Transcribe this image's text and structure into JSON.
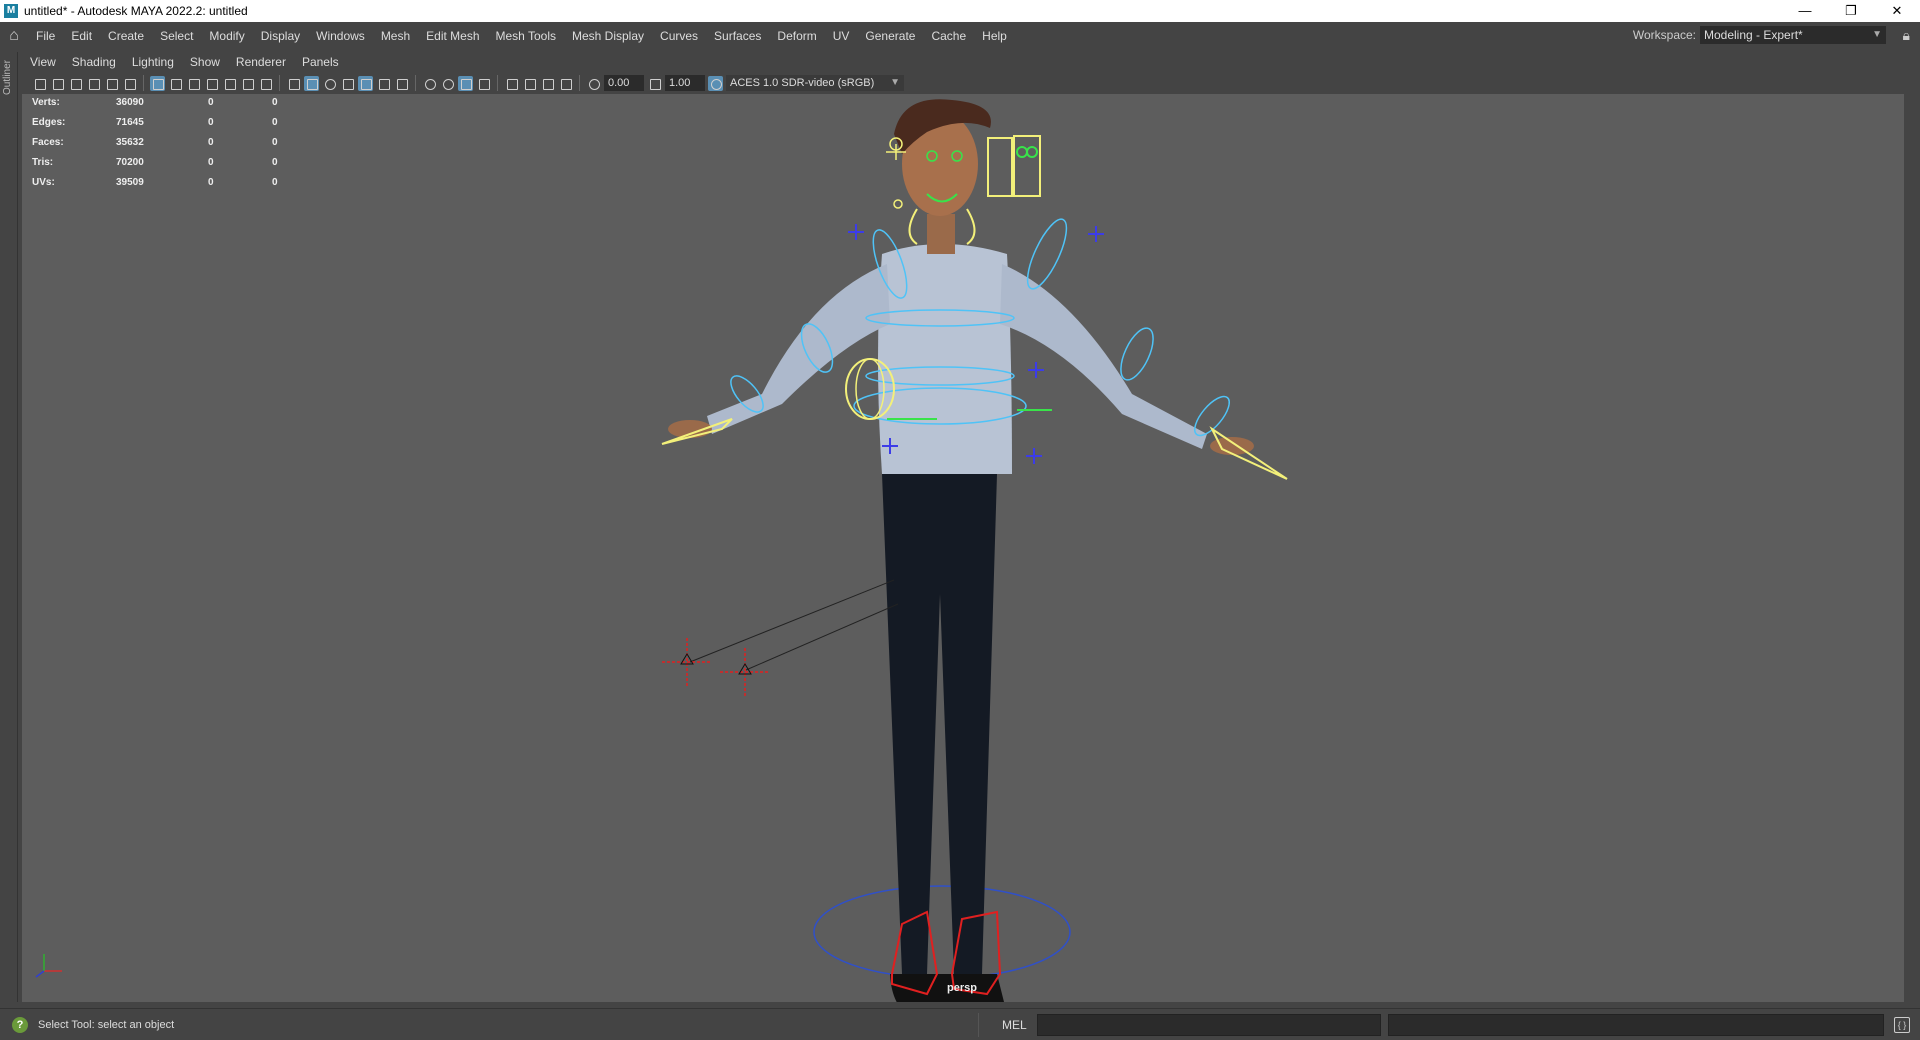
{
  "window": {
    "title": "untitled* - Autodesk MAYA 2022.2: untitled",
    "controls": [
      "—",
      "❐",
      "✕"
    ]
  },
  "main_menu": {
    "items": [
      "File",
      "Edit",
      "Create",
      "Select",
      "Modify",
      "Display",
      "Windows",
      "Mesh",
      "Edit Mesh",
      "Mesh Tools",
      "Mesh Display",
      "Curves",
      "Surfaces",
      "Deform",
      "UV",
      "Generate",
      "Cache",
      "Help"
    ],
    "workspace_label": "Workspace:",
    "workspace_value": "Modeling - Expert*"
  },
  "outliner_tab": "Outliner",
  "panel_menu": {
    "items": [
      "View",
      "Shading",
      "Lighting",
      "Show",
      "Renderer",
      "Panels"
    ]
  },
  "panel_toolbar": {
    "exposure": "0.00",
    "gamma": "1.00",
    "color_space": "ACES 1.0 SDR-video (sRGB)"
  },
  "heads_up_display": {
    "rows": [
      {
        "label": "Verts:",
        "v1": "36090",
        "v2": "0",
        "v3": "0"
      },
      {
        "label": "Edges:",
        "v1": "71645",
        "v2": "0",
        "v3": "0"
      },
      {
        "label": "Faces:",
        "v1": "35632",
        "v2": "0",
        "v3": "0"
      },
      {
        "label": "Tris:",
        "v1": "70200",
        "v2": "0",
        "v3": "0"
      },
      {
        "label": "UVs:",
        "v1": "39509",
        "v2": "0",
        "v3": "0"
      }
    ]
  },
  "viewport": {
    "camera_name": "persp",
    "background_color": "#5d5d5d",
    "rig_colors": {
      "ik_controls": "#4fc3f7",
      "fk_controls": "#f3f07a",
      "face_controls": "#39e34a",
      "foot_controls": "#e02020",
      "pole_vectors": "#3c3ce8"
    }
  },
  "status_line": {
    "help_text": "Select Tool: select an object",
    "command_language": "MEL"
  }
}
